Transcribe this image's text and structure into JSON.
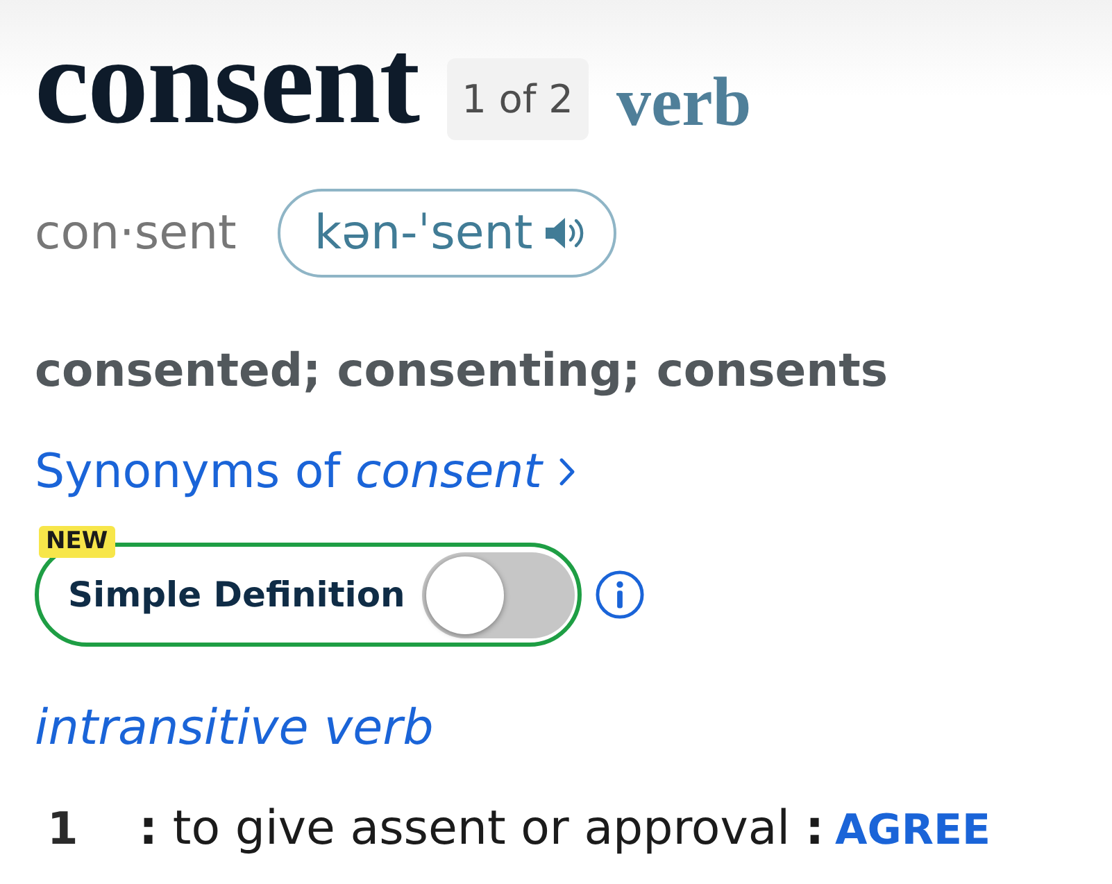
{
  "headword": {
    "text": "consent",
    "homograph": "1 of 2",
    "part_of_speech": "verb"
  },
  "syllables": "con·sent",
  "pronunciation": {
    "text": "kən-ˈsent"
  },
  "inflections": "consented; consenting; consents",
  "synonyms_link": "Synonyms of *consent*",
  "simple_definition": {
    "badge": "NEW",
    "label": "Simple Definition",
    "on": false
  },
  "sense_group": {
    "label": "intransitive verb",
    "senses": [
      {
        "number": "1",
        "text": "**:** to give assent or approval **:**",
        "cross_reference": "AGREE"
      }
    ]
  }
}
